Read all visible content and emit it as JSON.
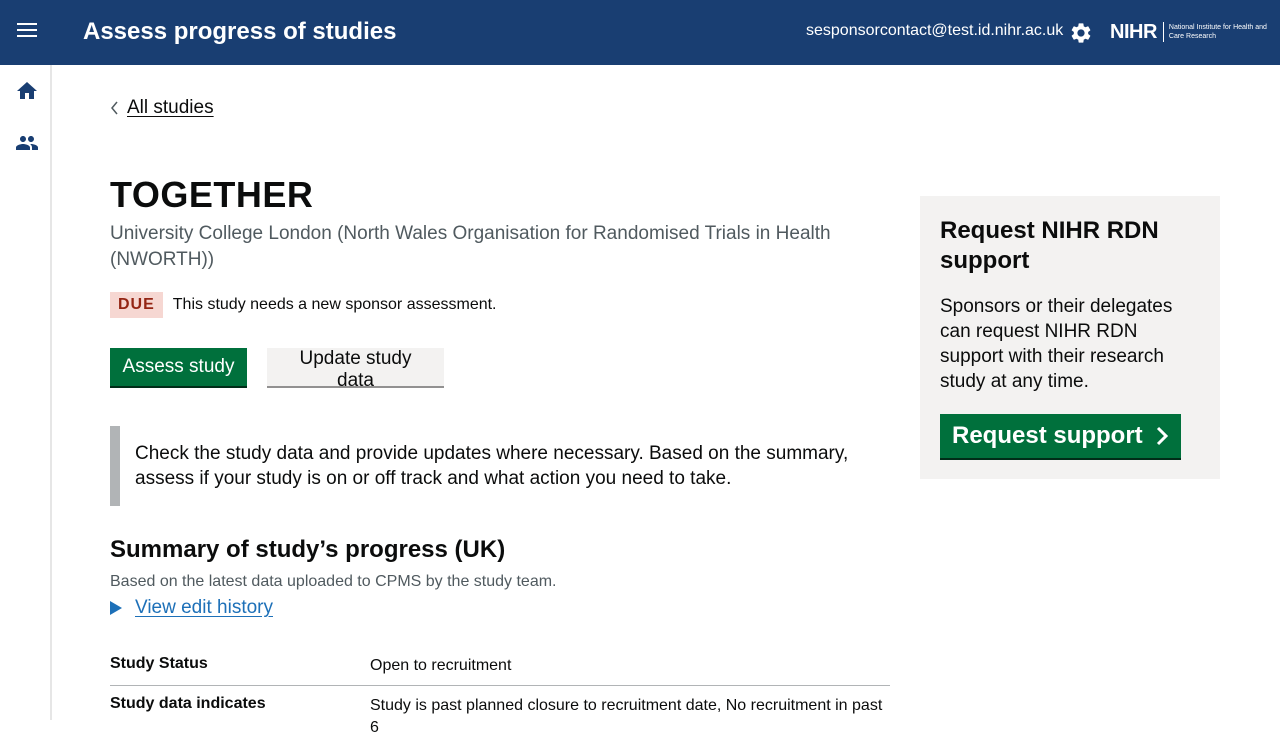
{
  "header": {
    "title": "Assess progress of studies",
    "user_email": "sesponsorcontact@test.id.nihr.ac.uk",
    "logo_main": "NIHR",
    "logo_sub": "National Institute for Health and Care Research"
  },
  "sidebar": {
    "items": [
      {
        "icon": "home-icon"
      },
      {
        "icon": "users-icon"
      }
    ]
  },
  "back_link": "All studies",
  "study": {
    "title": "TOGETHER",
    "organisation": "University College London (North Wales Organisation for Randomised Trials in Health (NWORTH))",
    "status_tag": "DUE",
    "status_text": "This study needs a new sponsor assessment."
  },
  "actions": {
    "assess": "Assess study",
    "update": "Update study data"
  },
  "inset_text": "Check the study data and provide updates where necessary. Based on the summary, assess if your study is on or off track and what action you need to take.",
  "summary": {
    "heading": "Summary of study’s progress (UK)",
    "subtext": "Based on the latest data uploaded to CPMS by the study team.",
    "history_link": "View edit history",
    "rows": [
      {
        "label": "Study Status",
        "value": "Open to recruitment"
      },
      {
        "label": "Study data indicates",
        "value": "Study is past planned closure to recruitment date, No recruitment in past 6"
      }
    ]
  },
  "panel": {
    "heading": "Request NIHR RDN support",
    "text": "Sponsors or their delegates can request NIHR RDN support with their research study at any time.",
    "button": "Request support"
  },
  "colors": {
    "header_bg": "#193e72",
    "primary_green": "#00703c",
    "link_blue": "#1d70b8",
    "due_tag_bg": "#f6d7d2",
    "due_tag_text": "#942514"
  }
}
